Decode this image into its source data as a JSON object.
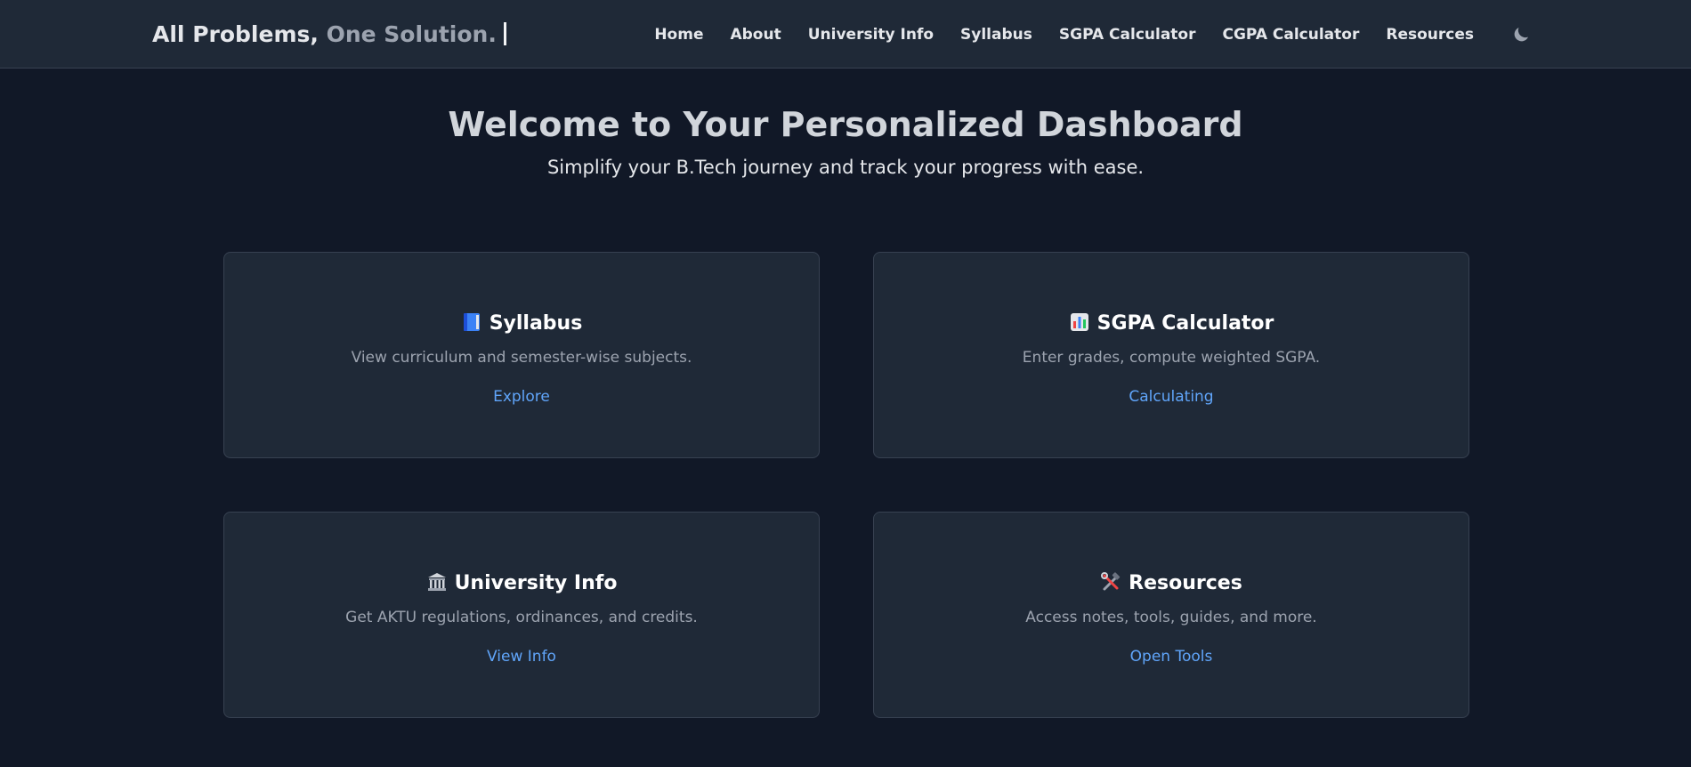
{
  "brand": {
    "part1": "All Problems,",
    "part2": "One Solution."
  },
  "nav": {
    "items": [
      {
        "label": "Home"
      },
      {
        "label": "About"
      },
      {
        "label": "University Info"
      },
      {
        "label": "Syllabus"
      },
      {
        "label": "SGPA Calculator"
      },
      {
        "label": "CGPA Calculator"
      },
      {
        "label": "Resources"
      }
    ],
    "theme_toggle_icon": "moon-icon"
  },
  "hero": {
    "title": "Welcome to Your Personalized Dashboard",
    "subtitle": "Simplify your B.Tech journey and track your progress with ease."
  },
  "cards": [
    {
      "icon": "blue-book-icon",
      "title": "Syllabus",
      "description": "View curriculum and semester-wise subjects.",
      "link": "Explore"
    },
    {
      "icon": "bar-chart-icon",
      "title": "SGPA Calculator",
      "description": "Enter grades, compute weighted SGPA.",
      "link": "Calculating"
    },
    {
      "icon": "classical-building-icon",
      "title": "University Info",
      "description": "Get AKTU regulations, ordinances, and credits.",
      "link": "View Info"
    },
    {
      "icon": "hammer-wrench-icon",
      "title": "Resources",
      "description": "Access notes, tools, guides, and more.",
      "link": "Open Tools"
    }
  ],
  "colors": {
    "background": "#111827",
    "surface": "#1f2937",
    "border": "#374151",
    "link": "#60a5fa"
  }
}
